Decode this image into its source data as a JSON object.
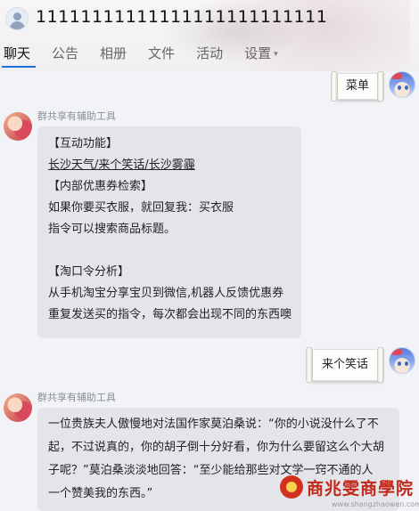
{
  "header": {
    "title": "11111111111111111111111111",
    "tabs": [
      {
        "label": "聊天"
      },
      {
        "label": "公告"
      },
      {
        "label": "相册"
      },
      {
        "label": "文件"
      },
      {
        "label": "活动"
      },
      {
        "label": "设置"
      }
    ],
    "settings_caret": "▾"
  },
  "messages": {
    "m1": {
      "text": "菜单"
    },
    "m2": {
      "sender": "群共享有辅助工具",
      "lines": [
        "【互动功能】",
        "长沙天气/来个笑话/长沙雾霾",
        "【内部优惠券检索】",
        "如果你要买衣服，就回复我：买衣服",
        "指令可以搜索商品标题。",
        "",
        "【淘口令分析】",
        "从手机淘宝分享宝贝到微信,机器人反馈优惠券",
        "重复发送买的指令，每次都会出现不同的东西噢"
      ]
    },
    "m3": {
      "text": "来个笑话"
    },
    "m4": {
      "sender": "群共享有辅助工具",
      "lines": [
        "一位贵族夫人傲慢地对法国作家莫泊桑说：“你的小说没什么了不",
        "起，不过说真的，你的胡子倒十分好看，你为什么要留这么个大胡",
        "子呢？”莫泊桑淡淡地回答：“至少能给那些对文学一窍不通的人",
        "一个赞美我的东西。”"
      ]
    }
  },
  "watermark": {
    "text": "商兆雯商學院",
    "url": "www.shangzhaowen.com"
  },
  "colors": {
    "accent": "#1e6fd9",
    "bubble": "#e3e5ea",
    "background": "#f2f3f6"
  }
}
